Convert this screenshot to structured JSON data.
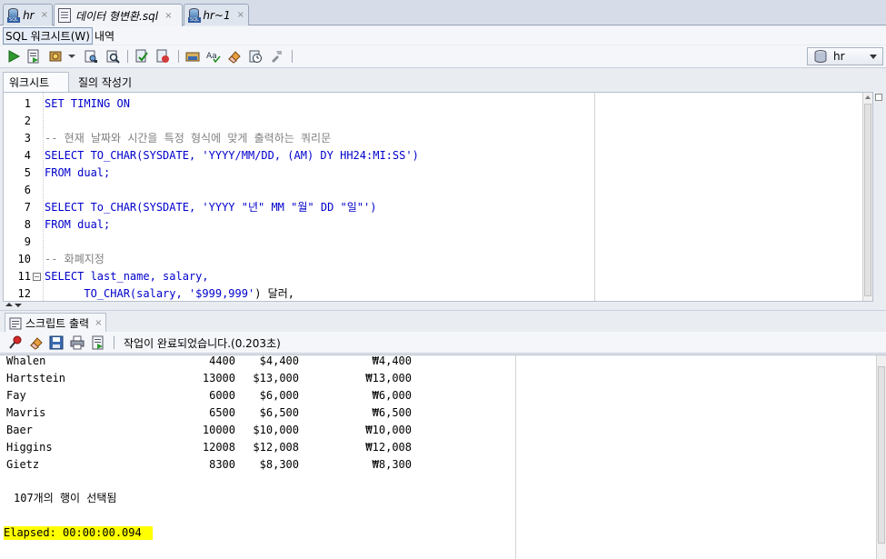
{
  "doc_tabs": [
    {
      "label": "hr",
      "active": false
    },
    {
      "label": "데이터 형변환.sql",
      "active": true
    },
    {
      "label": "hr~1",
      "active": false
    }
  ],
  "close_glyph": "×",
  "menu": {
    "worksheet": "SQL 워크시트(W)",
    "history": "내역"
  },
  "connection": {
    "name": "hr"
  },
  "ws_tabs": {
    "worksheet": "워크시트",
    "query_builder": "질의 작성기"
  },
  "code": {
    "line_numbers": [
      "1",
      "2",
      "3",
      "4",
      "5",
      "6",
      "7",
      "8",
      "9",
      "10",
      "11",
      "12"
    ],
    "l1": "SET TIMING ON",
    "l3": "-- 현재 날짜와 시간을 특정 형식에 맞게 출력하는 쿼리문",
    "l4a": "SELECT TO_CHAR(SYSDATE, ",
    "l4b": "'YYYY/MM/DD, (AM) DY HH24:MI:SS'",
    "l4c": ")",
    "l5": "FROM dual;",
    "l7a": "SELECT To_CHAR(SYSDATE, ",
    "l7b": "'YYYY \"년\" MM \"월\" DD \"일\"'",
    "l7c": ")",
    "l8": "FROM dual;",
    "l10": "-- 화폐지정",
    "l11": "SELECT last_name, salary,",
    "l12a": "      TO_CHAR(salary, ",
    "l12b": "'$999,999'",
    "l12c": ") 달러,"
  },
  "output": {
    "tab_label": "스크립트 출력",
    "status": "작업이 완료되었습니다.(0.203초)",
    "rows": [
      {
        "name": "Whalen",
        "salary": "4400",
        "dollar": "$4,400",
        "won": "₩4,400"
      },
      {
        "name": "Hartstein",
        "salary": "13000",
        "dollar": "$13,000",
        "won": "₩13,000"
      },
      {
        "name": "Fay",
        "salary": "6000",
        "dollar": "$6,000",
        "won": "₩6,000"
      },
      {
        "name": "Mavris",
        "salary": "6500",
        "dollar": "$6,500",
        "won": "₩6,500"
      },
      {
        "name": "Baer",
        "salary": "10000",
        "dollar": "$10,000",
        "won": "₩10,000"
      },
      {
        "name": "Higgins",
        "salary": "12008",
        "dollar": "$12,008",
        "won": "₩12,008"
      },
      {
        "name": "Gietz",
        "salary": "8300",
        "dollar": "$8,300",
        "won": "₩8,300"
      }
    ],
    "rows_selected": "107개의 행이 선택됨",
    "elapsed": "Elapsed: 00:00:00.094"
  }
}
